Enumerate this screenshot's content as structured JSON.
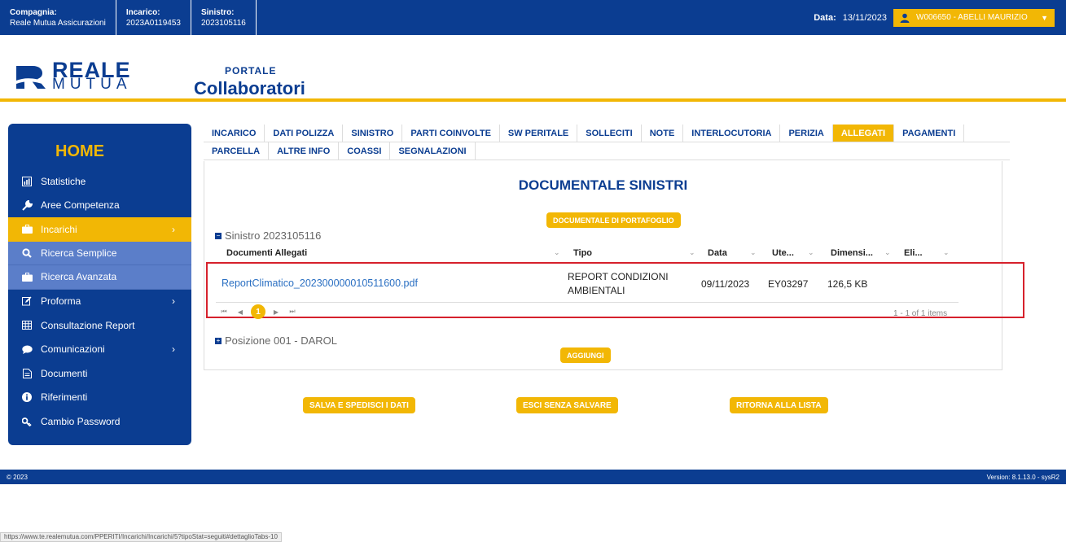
{
  "topbar": {
    "fields": [
      {
        "label": "Compagnia:",
        "value": "Reale Mutua Assicurazioni"
      },
      {
        "label": "Incarico:",
        "value": "2023A0119453"
      },
      {
        "label": "Sinistro:",
        "value": "2023105116"
      }
    ],
    "date_label": "Data:",
    "date_value": "13/11/2023",
    "user": "W006650 - ABELLI MAURIZIO"
  },
  "logo": {
    "line1": "REALE",
    "line2": "MUTUA"
  },
  "portal": {
    "line1": "PORTALE",
    "line2": "Collaboratori"
  },
  "sidebar": {
    "home": "HOME",
    "items": [
      {
        "label": "Statistiche",
        "icon": "chart-icon"
      },
      {
        "label": "Aree Competenza",
        "icon": "wrench-icon"
      },
      {
        "label": "Incarichi",
        "icon": "briefcase-icon"
      },
      {
        "label": "Ricerca Semplice",
        "icon": "search-icon"
      },
      {
        "label": "Ricerca Avanzata",
        "icon": "briefcase-icon"
      },
      {
        "label": "Proforma",
        "icon": "edit-icon"
      },
      {
        "label": "Consultazione Report",
        "icon": "table-icon"
      },
      {
        "label": "Comunicazioni",
        "icon": "chat-icon"
      },
      {
        "label": "Documenti",
        "icon": "document-icon"
      },
      {
        "label": "Riferimenti",
        "icon": "info-icon"
      },
      {
        "label": "Cambio Password",
        "icon": "key-icon"
      }
    ]
  },
  "tabs": {
    "row1": [
      "INCARICO",
      "DATI POLIZZA",
      "SINISTRO",
      "PARTI COINVOLTE",
      "SW PERITALE",
      "SOLLECITI",
      "NOTE",
      "INTERLOCUTORIA",
      "PERIZIA",
      "ALLEGATI",
      "PAGAMENTI"
    ],
    "row2": [
      "PARCELLA",
      "ALTRE INFO",
      "COASSI",
      "SEGNALAZIONI"
    ],
    "selected": "ALLEGATI"
  },
  "main": {
    "title": "DOCUMENTALE SINISTRI",
    "portfolio_button": "DOCUMENTALE DI PORTAFOGLIO",
    "section1": "Sinistro 2023105116",
    "columns": [
      "Documenti Allegati",
      "Tipo",
      "Data",
      "Ute...",
      "Dimensi...",
      "Eli..."
    ],
    "rows": [
      {
        "file": "ReportClimatico_202300000010511600.pdf",
        "tipo_line1": "REPORT CONDIZIONI",
        "tipo_line2": "AMBIENTALI",
        "data": "09/11/2023",
        "utente": "EY03297",
        "dimensione": "126,5 KB"
      }
    ],
    "pager": {
      "first": "⏮",
      "prev": "◀",
      "current": "1",
      "next": "▶",
      "last": "⏭",
      "items_text": "1 - 1 of 1 items"
    },
    "section2": "Posizione 001 - DAROL",
    "add_button": "AGGIUNGI"
  },
  "actions": {
    "save": "SALVA E SPEDISCI I DATI",
    "exit": "ESCI SENZA SALVARE",
    "back": "RITORNA ALLA LISTA"
  },
  "footer": {
    "left": "© 2023",
    "right": "Version: 8.1.13.0 - sysR2"
  },
  "status_url": "https://www.te.realemutua.com/PPERITI/Incarichi/Incarichi/5?tipoStat=seguiti#dettaglioTabs-10",
  "colors": {
    "primary": "#0b3d91",
    "accent": "#f2b705",
    "highlight": "#d6212c"
  }
}
